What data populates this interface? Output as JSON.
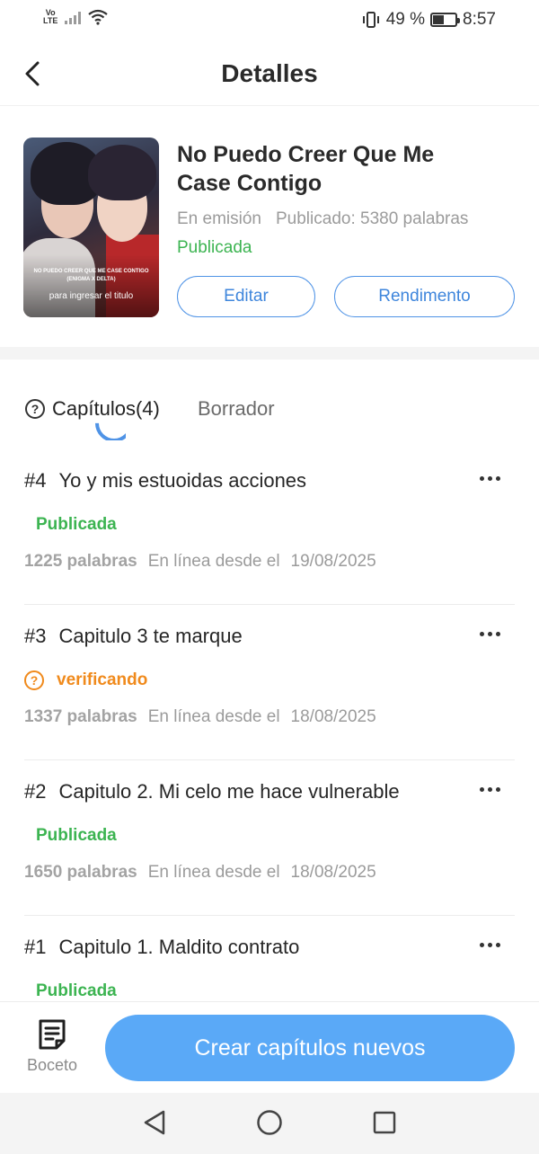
{
  "status_bar": {
    "network": "Vo LTE",
    "vibrate_icon": "vibrate-icon",
    "battery_percent": "49 %",
    "battery_level": 0.49,
    "time": "8:57"
  },
  "header": {
    "title": "Detalles"
  },
  "book": {
    "title": "No Puedo Creer Que Me Case Contigo",
    "cover_title": "NO PUEDO CREER QUE ME CASE CONTIGO (ENIGMA X DELTA)",
    "cover_caption": "para ingresar el titulo",
    "serial_status": "En emisión",
    "published_words": "Publicado: 5380 palabras",
    "status": "Publicada",
    "edit_label": "Editar",
    "performance_label": "Rendimento"
  },
  "tabs": {
    "chapters_label": "Capítulos(4)",
    "draft_label": "Borrador"
  },
  "chapters": [
    {
      "num": "#4",
      "title": "Yo y mis estuoidas acciones",
      "status": "Publicada",
      "words": "1225 palabras",
      "online_label": "En línea desde el",
      "date": "19/08/2025"
    },
    {
      "num": "#3",
      "title": "Capitulo 3 te marque",
      "status": "verificando",
      "words": "1337 palabras",
      "online_label": "En línea desde el",
      "date": "18/08/2025"
    },
    {
      "num": "#2",
      "title": "Capitulo 2. Mi celo me hace vulnerable",
      "status": "Publicada",
      "words": "1650 palabras",
      "online_label": "En línea desde el",
      "date": "18/08/2025"
    },
    {
      "num": "#1",
      "title": "Capitulo 1. Maldito contrato",
      "status": "Publicada"
    }
  ],
  "bottom_bar": {
    "sketch_label": "Boceto",
    "create_label": "Crear capítulos nuevos"
  },
  "colors": {
    "accent_blue": "#4f93e6",
    "create_button": "#5aa9f7",
    "published_green": "#3cb451",
    "verifying_orange": "#f08a1c"
  }
}
